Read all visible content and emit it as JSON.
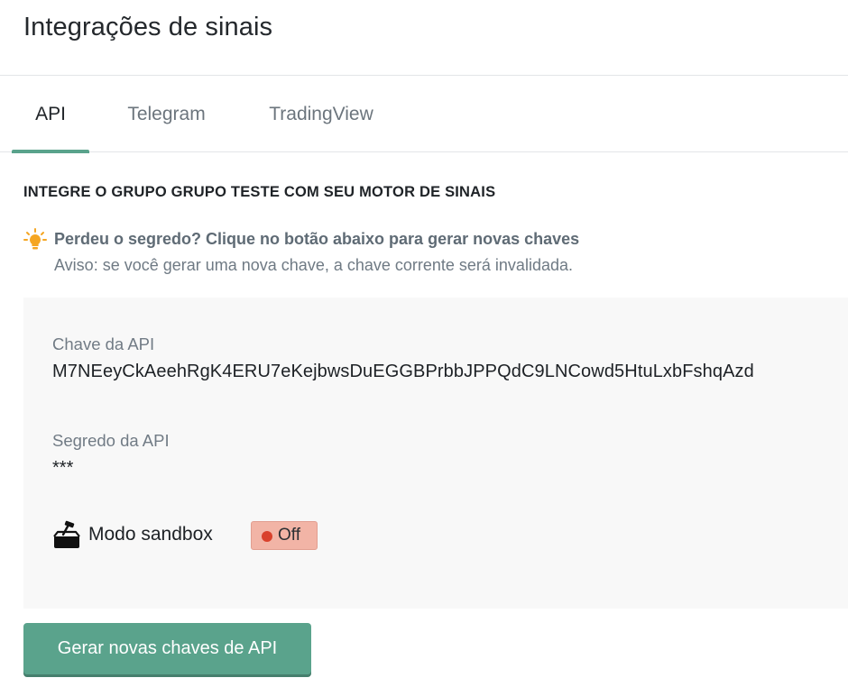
{
  "header": {
    "title": "Integrações de sinais"
  },
  "tabs": [
    {
      "label": "API",
      "active": true
    },
    {
      "label": "Telegram",
      "active": false
    },
    {
      "label": "TradingView",
      "active": false
    }
  ],
  "section": {
    "heading": "INTEGRE O GRUPO GRUPO TESTE COM SEU MOTOR DE SINAIS"
  },
  "hint": {
    "icon": "lightbulb-icon",
    "title": "Perdeu o segredo? Clique no botão abaixo para gerar novas chaves",
    "warning": "Aviso: se você gerar uma nova chave, a chave corrente será invalidada."
  },
  "panel": {
    "api_key_label": "Chave da API",
    "api_key_value": "M7NEeyCkAeehRgK4ERU7eKejbwsDuEGGBPrbbJPPQdC9LNCowd5HtuLxbFshqAzd",
    "api_secret_label": "Segredo da API",
    "api_secret_value": "***",
    "sandbox_icon": "sandbox-icon",
    "sandbox_label": "Modo sandbox",
    "sandbox_state": "Off"
  },
  "actions": {
    "generate_keys_label": "Gerar novas chaves de API"
  },
  "colors": {
    "accent": "#5aa38c",
    "toggle_off_bg": "#f2b4a6",
    "toggle_off_dot": "#d9412c",
    "panel_bg": "#f8f8f8",
    "hint_icon": "#f5a623"
  }
}
